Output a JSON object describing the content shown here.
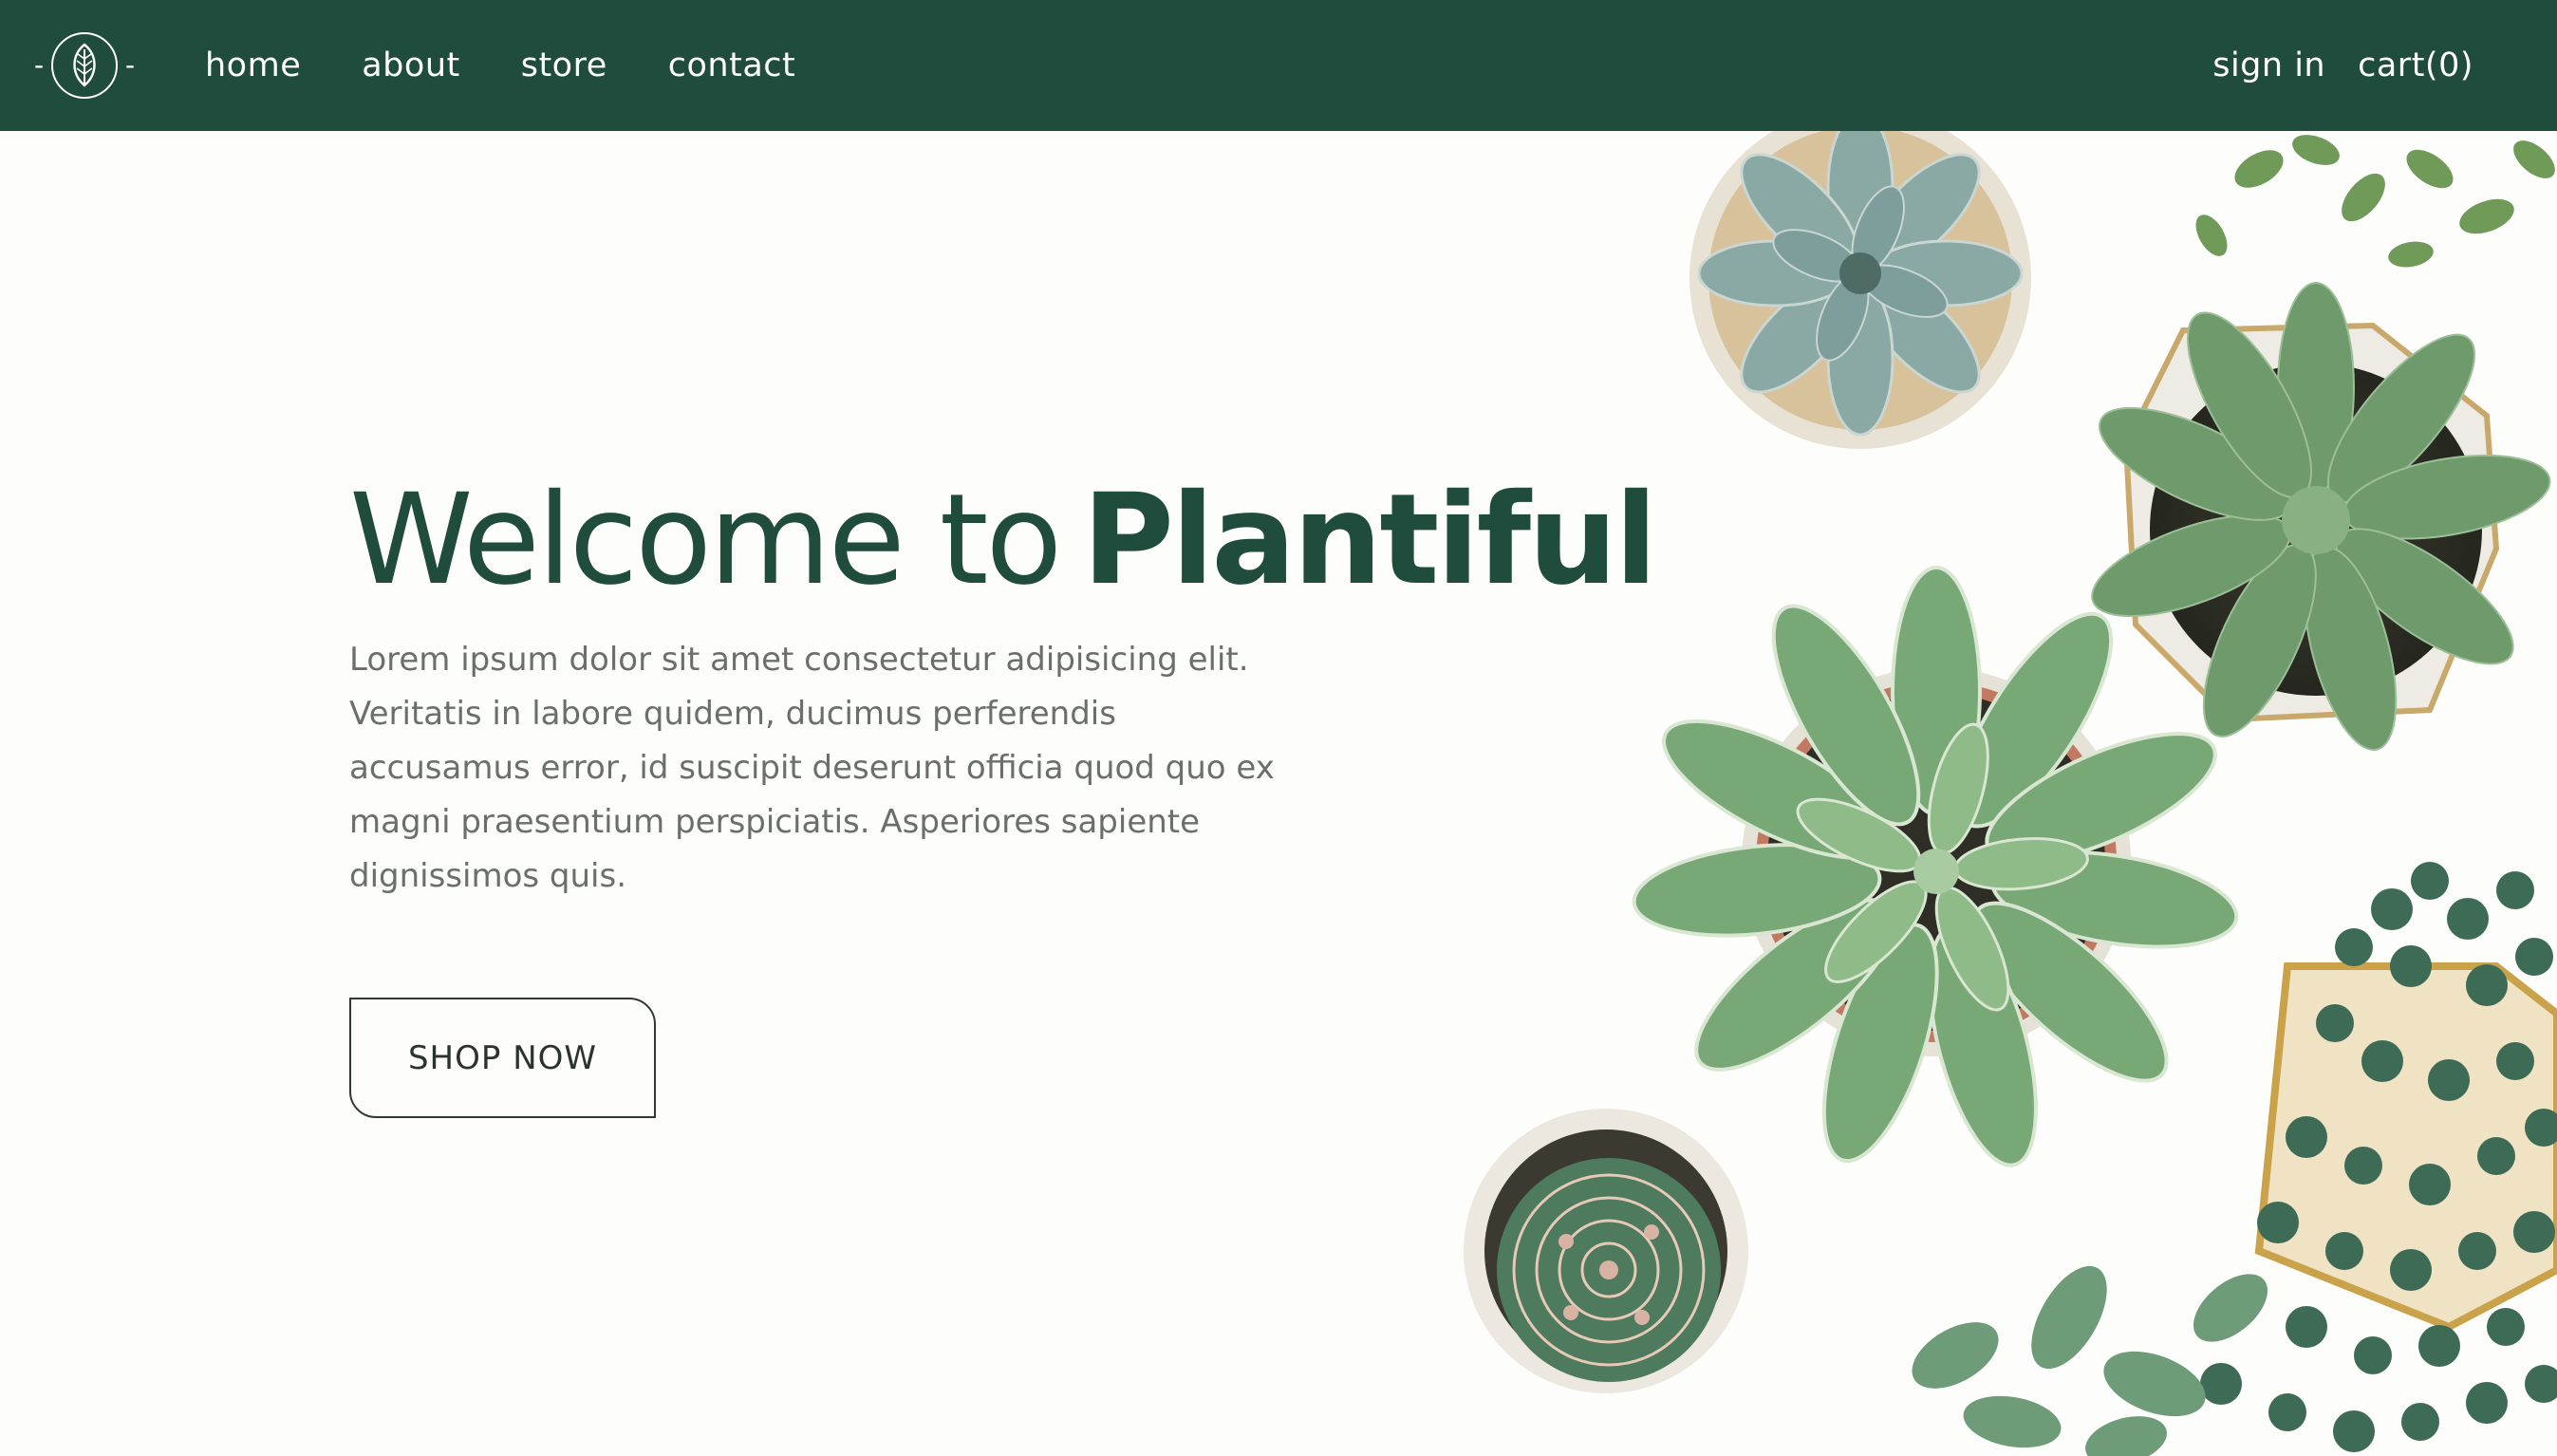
{
  "nav": {
    "brand_icon": "leaf-icon",
    "links": [
      "home",
      "about",
      "store",
      "contact"
    ],
    "sign_in": "sign in",
    "cart": "cart(0)"
  },
  "hero": {
    "headline_light": "Welcome to",
    "headline_bold": "Plantiful",
    "description": "Lorem ipsum dolor sit amet consectetur adipisicing elit. Veritatis in labore quidem, ducimus perferendis accusamus error, id suscipit deserunt officia quod quo ex magni praesentium perspiciatis. Asperiores sapiente dignissimos quis.",
    "cta_label": "SHOP NOW"
  },
  "colors": {
    "nav_bg": "#204c3d",
    "headline": "#204c3d",
    "body_text": "#6a6f6d",
    "background": "#fdfdfc"
  }
}
